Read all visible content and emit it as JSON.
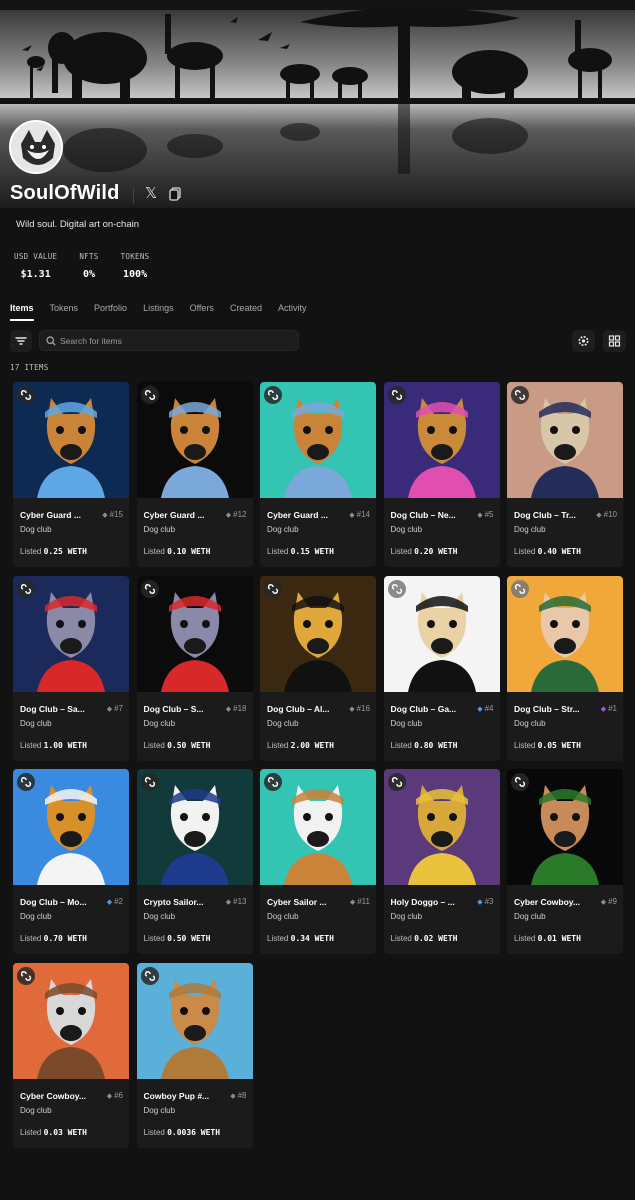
{
  "profile": {
    "name": "SoulOfWild",
    "bio": "Wild soul. Digital art on-chain"
  },
  "stats": [
    {
      "label": "USD VALUE",
      "value": "$1.31"
    },
    {
      "label": "NFTS",
      "value": "0%"
    },
    {
      "label": "TOKENS",
      "value": "100%"
    }
  ],
  "tabs": [
    "Items",
    "Tokens",
    "Portfolio",
    "Listings",
    "Offers",
    "Created",
    "Activity"
  ],
  "active_tab": "Items",
  "search": {
    "placeholder": "Search for items"
  },
  "items_count": "17 ITEMS",
  "items": [
    {
      "title": "Cyber Guard ...",
      "rank": "#15",
      "rank_color": "#8c8c8c",
      "collection": "Dog club",
      "listed": "Listed",
      "price": "0.25 WETH",
      "bg": "#0d2a52",
      "fg": "#c9843a",
      "accent": "#5ea7e6",
      "badge": "dark"
    },
    {
      "title": "Cyber Guard ...",
      "rank": "#12",
      "rank_color": "#8c8c8c",
      "collection": "Dog club",
      "listed": "Listed",
      "price": "0.10 WETH",
      "bg": "#0b0b0b",
      "fg": "#c9843a",
      "accent": "#7aa8d8",
      "badge": "dark"
    },
    {
      "title": "Cyber Guard ...",
      "rank": "#14",
      "rank_color": "#8c8c8c",
      "collection": "Dog club",
      "listed": "Listed",
      "price": "0.15 WETH",
      "bg": "#33c4b4",
      "fg": "#c9843a",
      "accent": "#7aa8d8",
      "badge": "dark"
    },
    {
      "title": "Dog Club – Ne...",
      "rank": "#5",
      "rank_color": "#8c8c8c",
      "collection": "Dog club",
      "listed": "Listed",
      "price": "0.20 WETH",
      "bg": "#3a2a7a",
      "fg": "#c98a3a",
      "accent": "#e04fb0",
      "badge": "dark"
    },
    {
      "title": "Dog Club – Tr...",
      "rank": "#10",
      "rank_color": "#8c8c8c",
      "collection": "Dog club",
      "listed": "Listed",
      "price": "0.40 WETH",
      "bg": "#c99a86",
      "fg": "#d8c6a8",
      "accent": "#242c5a",
      "badge": "dark"
    },
    {
      "title": "Dog Club – Sa...",
      "rank": "#7",
      "rank_color": "#8c8c8c",
      "collection": "Dog club",
      "listed": "Listed",
      "price": "1.00 WETH",
      "bg": "#1b2a5a",
      "fg": "#8a8aa8",
      "accent": "#d8282a",
      "badge": "dark"
    },
    {
      "title": "Dog Club – S...",
      "rank": "#18",
      "rank_color": "#8c8c8c",
      "collection": "Dog club",
      "listed": "Listed",
      "price": "0.50 WETH",
      "bg": "#0b0b0b",
      "fg": "#8a8aa8",
      "accent": "#d8282a",
      "badge": "dark"
    },
    {
      "title": "Dog Club – Al...",
      "rank": "#16",
      "rank_color": "#8c8c8c",
      "collection": "Dog club",
      "listed": "Listed",
      "price": "2.00 WETH",
      "bg": "#3a2810",
      "fg": "#e0a83a",
      "accent": "#111111",
      "badge": "dark"
    },
    {
      "title": "Dog Club – Ga...",
      "rank": "#4",
      "rank_color": "#4a9af0",
      "collection": "Dog club",
      "listed": "Listed",
      "price": "0.80 WETH",
      "bg": "#f4f4f4",
      "fg": "#e8d2a6",
      "accent": "#111111",
      "badge": "light"
    },
    {
      "title": "Dog Club – Str...",
      "rank": "#1",
      "rank_color": "#a05ae0",
      "collection": "Dog club",
      "listed": "Listed",
      "price": "0.05 WETH",
      "bg": "#f0a83a",
      "fg": "#e8c8a8",
      "accent": "#2a6a3a",
      "badge": "light"
    },
    {
      "title": "Dog Club – Mo...",
      "rank": "#2",
      "rank_color": "#4a9af0",
      "collection": "Dog club",
      "listed": "Listed",
      "price": "0.70 WETH",
      "bg": "#3a8ae0",
      "fg": "#d8902a",
      "accent": "#f4f4f4",
      "badge": "dark"
    },
    {
      "title": "Crypto Sailor...",
      "rank": "#13",
      "rank_color": "#8c8c8c",
      "collection": "Dog club",
      "listed": "Listed",
      "price": "0.50 WETH",
      "bg": "#123a3a",
      "fg": "#f2f2f2",
      "accent": "#1e3a8a",
      "badge": "dark"
    },
    {
      "title": "Cyber Sailor ...",
      "rank": "#11",
      "rank_color": "#8c8c8c",
      "collection": "Dog club",
      "listed": "Listed",
      "price": "0.34 WETH",
      "bg": "#33c4b4",
      "fg": "#f2f2f2",
      "accent": "#c9843a",
      "badge": "dark"
    },
    {
      "title": "Holy Doggo – ...",
      "rank": "#3",
      "rank_color": "#4a9af0",
      "collection": "Dog club",
      "listed": "Listed",
      "price": "0.02 WETH",
      "bg": "#5a3a7a",
      "fg": "#d8a83a",
      "accent": "#e8c23a",
      "badge": "dark"
    },
    {
      "title": "Cyber Cowboy...",
      "rank": "#9",
      "rank_color": "#8c8c8c",
      "collection": "Dog club",
      "listed": "Listed",
      "price": "0.01 WETH",
      "bg": "#080808",
      "fg": "#c98a5a",
      "accent": "#2a7a2a",
      "badge": "dark"
    },
    {
      "title": "Cyber Cowboy...",
      "rank": "#6",
      "rank_color": "#8c8c8c",
      "collection": "Dog club",
      "listed": "Listed",
      "price": "0.03 WETH",
      "bg": "#e06a3a",
      "fg": "#d8d8d8",
      "accent": "#7a4a2a",
      "badge": "dark"
    },
    {
      "title": "Cowboy Pup #...",
      "rank": "#8",
      "rank_color": "#8c8c8c",
      "collection": "Dog club",
      "listed": "Listed",
      "price": "0.0036 WETH",
      "bg": "#5ab0d8",
      "fg": "#c98a4a",
      "accent": "#b07a3a",
      "badge": "dark"
    }
  ]
}
